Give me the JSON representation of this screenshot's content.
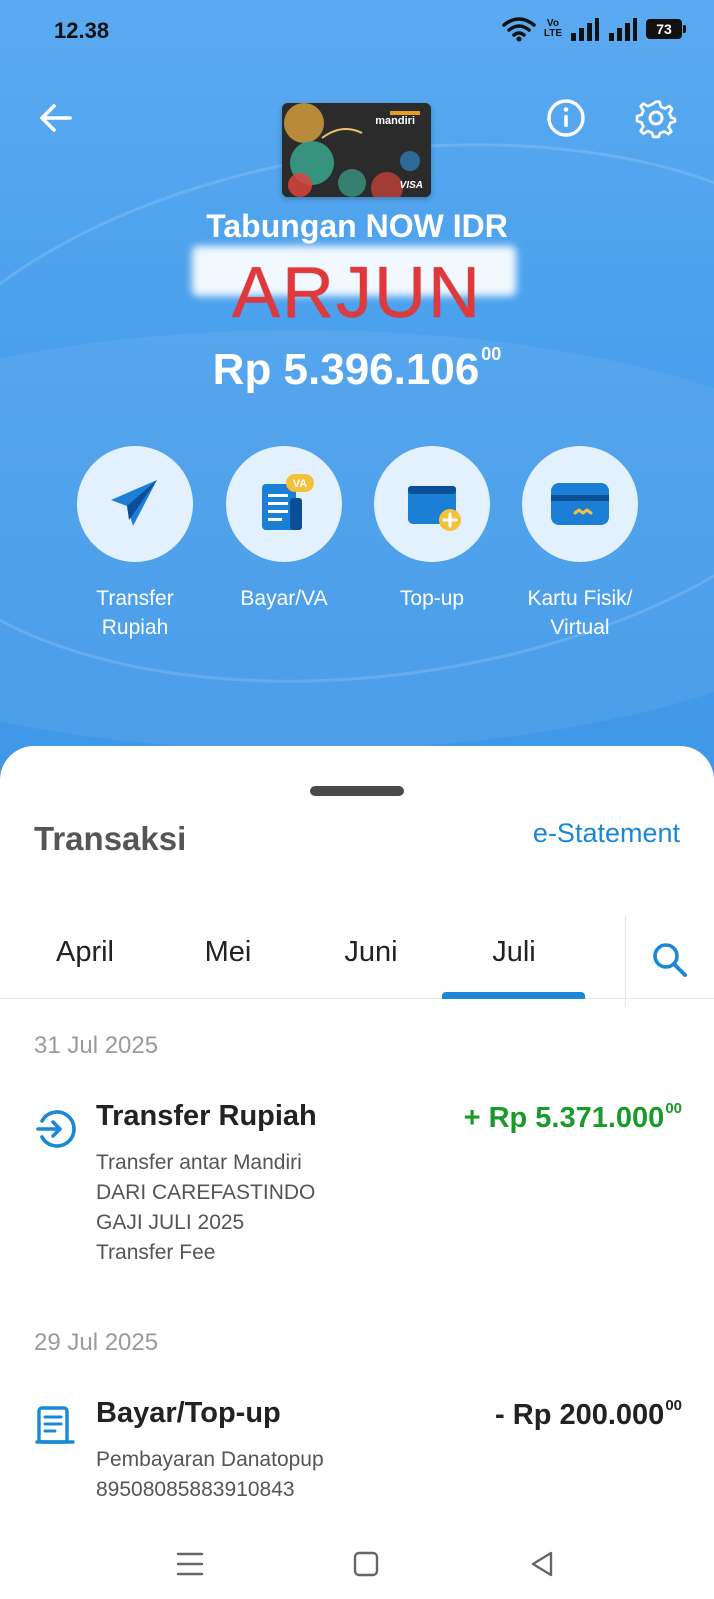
{
  "status_bar": {
    "time": "12.38",
    "network_label_top": "Vo",
    "network_label_bottom": "LTE",
    "battery": "73"
  },
  "header": {
    "back_icon": "arrow-left-icon",
    "info_icon": "info-circle-icon",
    "settings_icon": "gear-icon",
    "card_brand": "mandiri",
    "card_network": "VISA"
  },
  "account": {
    "type": "Tabungan NOW IDR",
    "owner_overlay": "ARJUN",
    "balance_main": "Rp 5.396.106",
    "balance_cents": "00"
  },
  "actions": [
    {
      "label_line1": "Transfer",
      "label_line2": "Rupiah",
      "icon": "paper-plane-icon"
    },
    {
      "label_line1": "Bayar/VA",
      "label_line2": "",
      "icon": "bill-va-icon",
      "badge": "VA"
    },
    {
      "label_line1": "Top-up",
      "label_line2": "",
      "icon": "wallet-add-icon"
    },
    {
      "label_line1": "Kartu Fisik/",
      "label_line2": "Virtual",
      "icon": "card-icon"
    }
  ],
  "transactions": {
    "title": "Transaksi",
    "estatement_label": "e-Statement",
    "tabs": [
      "April",
      "Mei",
      "Juni",
      "Juli"
    ],
    "active_tab": "Juli",
    "groups": [
      {
        "date": "31 Jul 2025",
        "items": [
          {
            "title": "Transfer Rupiah",
            "amount_main": "+ Rp 5.371.000",
            "amount_cents": "00",
            "direction": "credit",
            "icon": "transfer-in-icon",
            "lines": [
              "Transfer antar Mandiri",
              "DARI CAREFASTINDO",
              "GAJI JULI 2025",
              "Transfer Fee"
            ]
          }
        ]
      },
      {
        "date": "29 Jul 2025",
        "items": [
          {
            "title": "Bayar/Top-up",
            "amount_main": "- Rp 200.000",
            "amount_cents": "00",
            "direction": "debit",
            "icon": "receipt-icon",
            "lines": [
              "Pembayaran Danatopup",
              "89508085883910843"
            ]
          }
        ]
      }
    ]
  },
  "colors": {
    "hero_blue": "#4aa0ec",
    "accent_blue": "#1a88d6",
    "credit_green": "#1a9a2b",
    "overlay_red": "#e0393c"
  }
}
